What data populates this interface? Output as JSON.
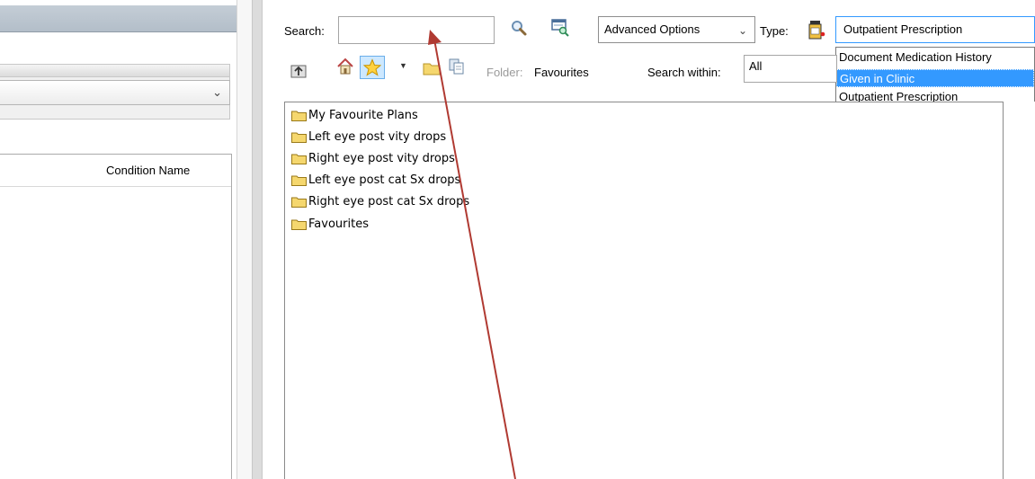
{
  "left_panel": {
    "list_header": {
      "condition_name": "Condition Name"
    }
  },
  "search": {
    "label": "Search:",
    "value": ""
  },
  "advanced_options": {
    "label": "Advanced Options"
  },
  "type": {
    "label": "Type:",
    "selected": "Outpatient Prescription",
    "options": [
      "Document Medication History",
      "Given in Clinic",
      "Outpatient Prescription"
    ],
    "highlighted_index": 1
  },
  "folder": {
    "label": "Folder:",
    "value": "Favourites"
  },
  "search_within": {
    "label": "Search within:",
    "value": "All"
  },
  "tree": {
    "items": [
      {
        "label": "My Favourite Plans"
      },
      {
        "label": "Left eye post vity drops"
      },
      {
        "label": "Right eye post vity drops"
      },
      {
        "label": "Left eye post cat Sx drops"
      },
      {
        "label": "Right eye post cat Sx drops"
      },
      {
        "label": "Favourites"
      }
    ]
  },
  "icons": {
    "search": "search-icon",
    "search_results": "search-results-icon",
    "type": "medication-bottle-icon",
    "folder_up": "folder-up-icon",
    "home": "home-icon",
    "favourites": "star-icon",
    "new_folder": "new-folder-icon",
    "copy": "copy-icon",
    "tree_folder": "folder-icon"
  },
  "colors": {
    "selection": "#3399ff",
    "folder": "#f5d76e",
    "annotation_arrow": "#b03a32",
    "titlebar": "#b9c3cd"
  }
}
